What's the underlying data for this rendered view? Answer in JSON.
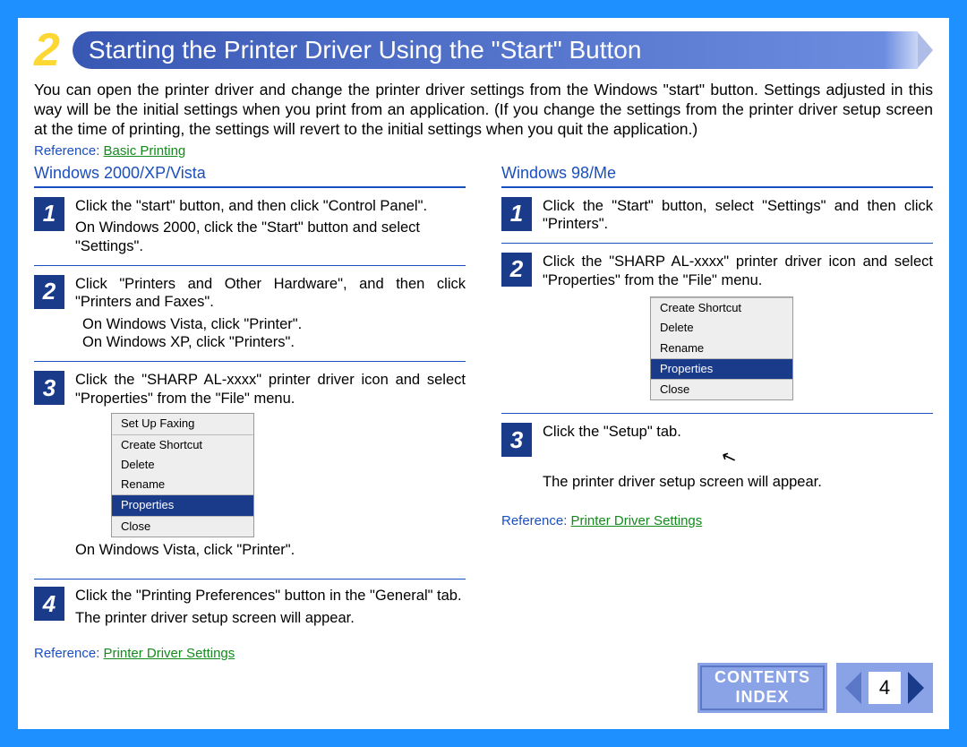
{
  "header": {
    "section_number": "2",
    "title": "Starting the Printer Driver Using the \"Start\" Button"
  },
  "intro": "You can open the printer driver and change the printer driver settings from the Windows \"start\" button. Settings adjusted in this way will be the initial settings when you print from an application. (If you change the settings from the printer driver setup screen at the time of printing, the settings will revert to the initial settings when you quit the application.)",
  "ref_top": {
    "label": "Reference:",
    "link": "Basic Printing"
  },
  "left": {
    "heading": "Windows 2000/XP/Vista",
    "steps": [
      {
        "num": "1",
        "main": "Click the \"start\" button, and then click \"Control Panel\".",
        "sub": "On Windows 2000, click the \"Start\" button and select \"Settings\"."
      },
      {
        "num": "2",
        "main": "Click \"Printers and Other Hardware\", and then click \"Printers and Faxes\".",
        "sub": "On Windows Vista, click \"Printer\".\nOn Windows XP, click \"Printers\"."
      },
      {
        "num": "3",
        "main": "Click the \"SHARP AL-xxxx\" printer driver icon and select \"Properties\" from the \"File\" menu.",
        "menu": [
          "Set Up Faxing",
          "Create Shortcut",
          "Delete",
          "Rename",
          "Properties",
          "Close"
        ],
        "after": "On Windows Vista, click \"Printer\"."
      },
      {
        "num": "4",
        "main": "Click the \"Printing Preferences\" button in the \"General\" tab.",
        "sub": "The printer driver setup screen will appear."
      }
    ],
    "ref": {
      "label": "Reference:",
      "link": "Printer Driver Settings"
    }
  },
  "right": {
    "heading": "Windows 98/Me",
    "steps": [
      {
        "num": "1",
        "main": "Click the \"Start\" button, select \"Settings\" and then click \"Printers\"."
      },
      {
        "num": "2",
        "main": "Click the \"SHARP AL-xxxx\" printer driver icon and select \"Properties\" from the \"File\" menu.",
        "menu": [
          "Create Shortcut",
          "Delete",
          "Rename",
          "Properties",
          "Close"
        ]
      },
      {
        "num": "3",
        "main": "Click the \"Setup\" tab.",
        "after": "The printer driver setup screen will appear."
      }
    ],
    "ref": {
      "label": "Reference:",
      "link": "Printer Driver Settings"
    }
  },
  "footer": {
    "contents": "CONTENTS",
    "index": "INDEX",
    "page": "4"
  }
}
